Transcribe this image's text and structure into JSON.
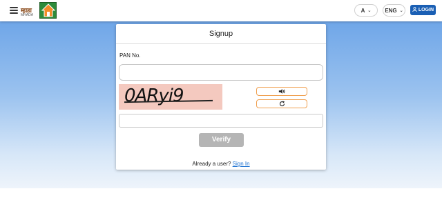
{
  "header": {
    "logo_text": "म्हाडा",
    "logo_sub": "MHADA",
    "font_size_pill": "A",
    "language_pill": "ENG",
    "login_label": "LOGIN"
  },
  "icons": {
    "menu": "hamburger-icon",
    "dropdown": "chevron-down-icon",
    "user": "user-icon",
    "audio": "speaker-icon",
    "refresh": "refresh-icon"
  },
  "signup": {
    "title": "Signup",
    "pan_label": "PAN No.",
    "pan_value": "",
    "captcha_text": "0ARyi9",
    "captcha_input_value": "",
    "verify_label": "Verify",
    "already_text": "Already a user?",
    "signin_link": "Sign In"
  },
  "colors": {
    "login_button": "#1a5fb4",
    "verify_button_disabled": "#b5b5b5",
    "captcha_border": "#f0a050",
    "captcha_bg": "#f4c9bf",
    "link": "#1a6fd0"
  }
}
